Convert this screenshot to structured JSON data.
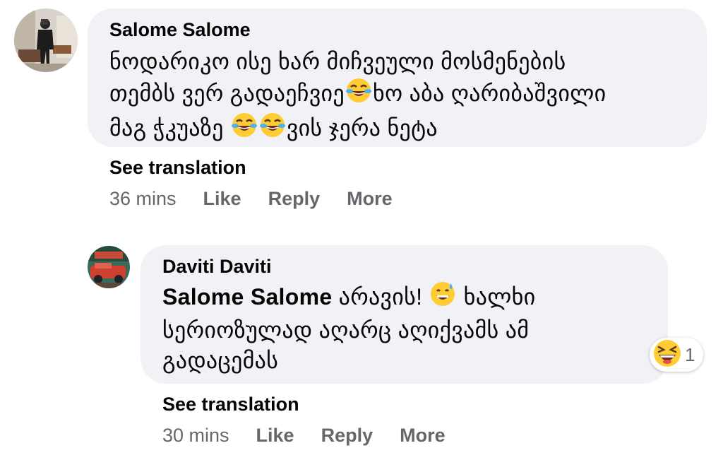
{
  "comments": [
    {
      "author": "Salome Salome",
      "lines": [
        "ნოდარიკო ისე ხარ მიჩვეული მოსმენების",
        "თემბს ვერ გადაეჩვიე",
        "ხო აბა ღარიბაშვილი",
        "მაგ ჭკუაზე ",
        "ვის ჯერა ნეტა"
      ],
      "emojis": [
        "face-with-tears-of-joy",
        "face-with-tears-of-joy",
        "face-with-tears-of-joy"
      ],
      "see_translation": "See translation",
      "time": "36 mins",
      "like": "Like",
      "reply": "Reply",
      "more": "More"
    },
    {
      "author": "Daviti Daviti",
      "mention": "Salome Salome",
      "lines": [
        " არავის! ",
        " ხალხი",
        "სერიოზულად აღარც აღიქვამს ამ",
        "გადაცემას"
      ],
      "emojis": [
        "grinning-face-with-sweat"
      ],
      "reaction": {
        "emoji": "laughing-squinting-face",
        "count": "1"
      },
      "see_translation": "See translation",
      "time": "30 mins",
      "like": "Like",
      "reply": "Reply",
      "more": "More"
    }
  ]
}
